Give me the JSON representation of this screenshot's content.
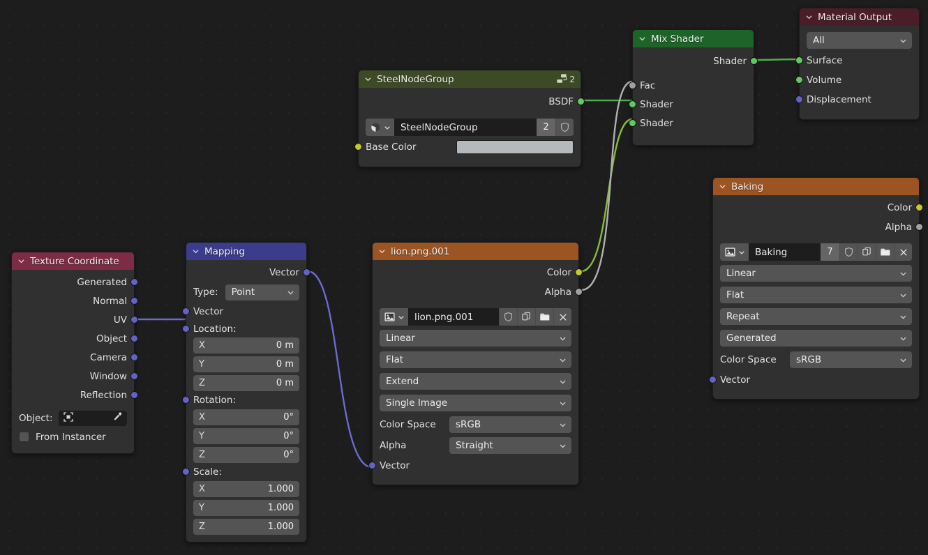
{
  "editor": {
    "name": "Blender Shader Node Editor",
    "background": "#1d1d1d"
  },
  "colors": {
    "header_texcoord": "#7c2c44",
    "header_mapping": "#3b3c8c",
    "header_image": "#9c5422",
    "header_group": "#3d4a26",
    "header_mix": "#1e6327",
    "header_output": "#4a1d28",
    "socket_vector": "#6363c7",
    "socket_shader": "#63c763",
    "socket_color": "#c7c729",
    "socket_grey": "#a1a1a1",
    "wire_vector": "#6a6ad0",
    "wire_shader": "#4eae4e",
    "wire_color": "#c7c729",
    "wire_grey": "#b0b0b0",
    "base_color_swatch": "#b4b9bc",
    "node_body": "#303030"
  },
  "nodes": {
    "texture_coordinate": {
      "title": "Texture Coordinate",
      "outputs": [
        "Generated",
        "Normal",
        "UV",
        "Object",
        "Camera",
        "Window",
        "Reflection"
      ],
      "object_label": "Object:",
      "object_value": "",
      "from_instancer_label": "From Instancer",
      "from_instancer_checked": false
    },
    "mapping": {
      "title": "Mapping",
      "output_label": "Vector",
      "type_label": "Type:",
      "type_value": "Point",
      "input_vector": "Vector",
      "location_label": "Location:",
      "location": [
        {
          "axis": "X",
          "value": "0 m"
        },
        {
          "axis": "Y",
          "value": "0 m"
        },
        {
          "axis": "Z",
          "value": "0 m"
        }
      ],
      "rotation_label": "Rotation:",
      "rotation": [
        {
          "axis": "X",
          "value": "0°"
        },
        {
          "axis": "Y",
          "value": "0°"
        },
        {
          "axis": "Z",
          "value": "0°"
        }
      ],
      "scale_label": "Scale:",
      "scale": [
        {
          "axis": "X",
          "value": "1.000"
        },
        {
          "axis": "Y",
          "value": "1.000"
        },
        {
          "axis": "Z",
          "value": "1.000"
        }
      ]
    },
    "lion_image": {
      "title": "lion.png.001",
      "outputs": [
        "Color",
        "Alpha"
      ],
      "datablock_name": "lion.png.001",
      "datablock_users": "",
      "interpolation": "Linear",
      "projection": "Flat",
      "extension": "Extend",
      "source": "Single Image",
      "color_space_label": "Color Space",
      "color_space_value": "sRGB",
      "alpha_label": "Alpha",
      "alpha_value": "Straight",
      "input_vector": "Vector"
    },
    "steel_node_group": {
      "title": "SteelNodeGroup",
      "group_users_badge": "2",
      "output_label": "BSDF",
      "datablock_name": "SteelNodeGroup",
      "datablock_users": "2",
      "base_color_label": "Base Color",
      "base_color_value": "#b4b9bc"
    },
    "mix_shader": {
      "title": "Mix Shader",
      "output_label": "Shader",
      "inputs": [
        "Fac",
        "Shader",
        "Shader"
      ]
    },
    "material_output": {
      "title": "Material Output",
      "target_value": "All",
      "inputs": [
        "Surface",
        "Volume",
        "Displacement"
      ]
    },
    "baking": {
      "title": "Baking",
      "outputs": [
        "Color",
        "Alpha"
      ],
      "datablock_name": "Baking",
      "datablock_users": "7",
      "interpolation": "Linear",
      "projection": "Flat",
      "extension": "Repeat",
      "source": "Generated",
      "color_space_label": "Color Space",
      "color_space_value": "sRGB",
      "input_vector": "Vector"
    }
  },
  "links": [
    {
      "from": "texture_coordinate.UV",
      "to": "mapping.Vector",
      "type": "vector"
    },
    {
      "from": "mapping.Vector",
      "to": "lion_image.Vector",
      "type": "vector"
    },
    {
      "from": "steel_node_group.BSDF",
      "to": "mix_shader.Shader1",
      "type": "shader"
    },
    {
      "from": "lion_image.Color",
      "to": "mix_shader.Shader2",
      "type": "color"
    },
    {
      "from": "lion_image.Alpha",
      "to": "mix_shader.Fac",
      "type": "grey"
    },
    {
      "from": "mix_shader.Shader",
      "to": "material_output.Surface",
      "type": "shader"
    }
  ]
}
